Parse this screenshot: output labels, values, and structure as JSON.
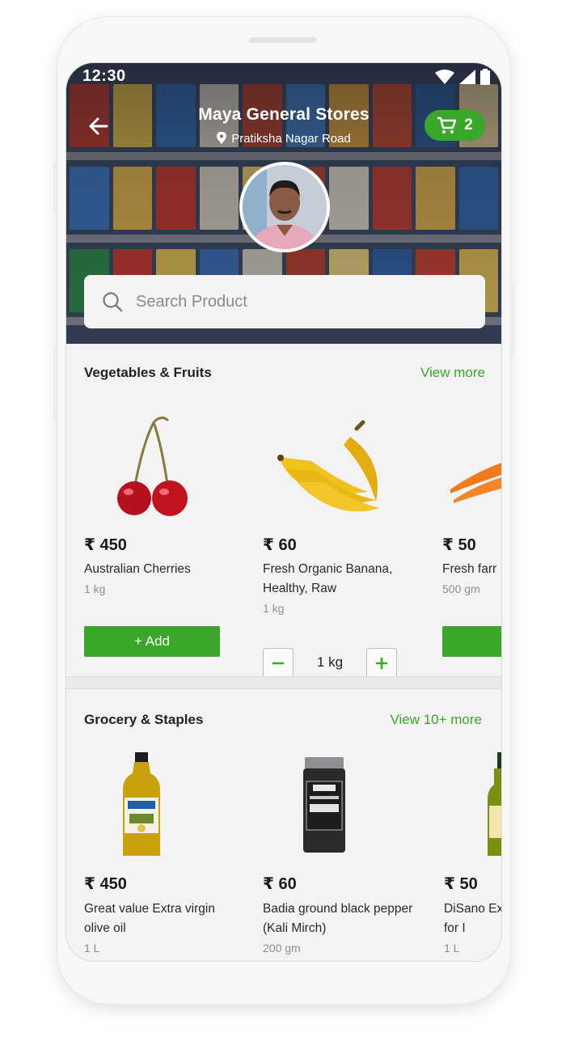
{
  "status_bar": {
    "time": "12:30"
  },
  "store": {
    "name": "Maya General Stores",
    "location": "Pratiksha Nagar Road",
    "cart_count": "2"
  },
  "search": {
    "placeholder": "Search Product"
  },
  "sections": [
    {
      "title": "Vegetables & Fruits",
      "link": "View more",
      "products": [
        {
          "price": "₹ 450",
          "name": "Australian Cherries",
          "qty": "1 kg",
          "action": "+ Add",
          "icon": "cherries-image"
        },
        {
          "price": "₹ 60",
          "name": "Fresh Organic Banana, Healthy, Raw",
          "qty": "1 kg",
          "stepper_value": "1 kg",
          "icon": "banana-image"
        },
        {
          "price": "₹ 50",
          "name": "Fresh farr",
          "qty": "500 gm",
          "action": "+",
          "icon": "carrot-image"
        }
      ]
    },
    {
      "title": "Grocery & Staples",
      "link": "View 10+ more",
      "products": [
        {
          "price": "₹ 450",
          "name": "Great value Extra virgin olive oil",
          "qty": "1 L",
          "icon": "olive-oil-bottle-image"
        },
        {
          "price": "₹ 60",
          "name": "Badia ground black pepper (Kali Mirch)",
          "qty": "200 gm",
          "icon": "pepper-jar-image"
        },
        {
          "price": "₹ 50",
          "name": "DiSano Ex Ideal for I",
          "qty": "1 L",
          "icon": "oil-bottle-image"
        }
      ]
    }
  ],
  "colors": {
    "accent": "#3aa62a",
    "text": "#222222",
    "muted": "#8d8d8d"
  }
}
